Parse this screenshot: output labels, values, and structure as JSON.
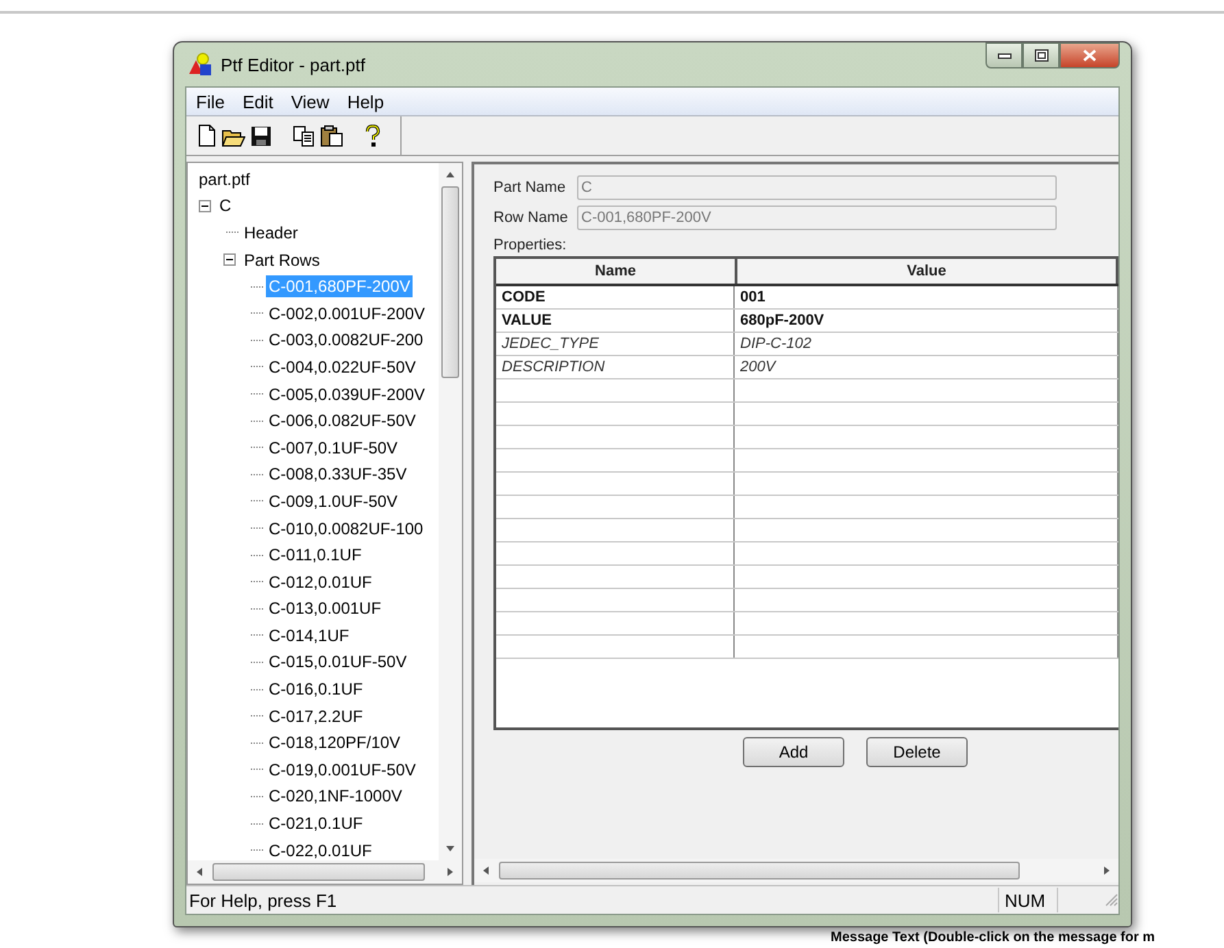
{
  "background": {
    "message_header": "Message Text (Double-click on the message for m"
  },
  "window": {
    "title": "Ptf Editor - part.ptf"
  },
  "menu": [
    "File",
    "Edit",
    "View",
    "Help"
  ],
  "tree": {
    "label": "part.ptf",
    "children": [
      {
        "label": "C",
        "expanded": true,
        "children": [
          {
            "label": "Header"
          },
          {
            "label": "Part Rows",
            "expanded": true,
            "children": [
              {
                "label": "C-001,680PF-200V",
                "selected": true
              },
              {
                "label": "C-002,0.001UF-200V",
                "selected": false
              },
              {
                "label": "C-003,0.0082UF-200",
                "selected": false
              },
              {
                "label": "C-004,0.022UF-50V",
                "selected": false
              },
              {
                "label": "C-005,0.039UF-200V",
                "selected": false
              },
              {
                "label": "C-006,0.082UF-50V",
                "selected": false
              },
              {
                "label": "C-007,0.1UF-50V",
                "selected": false
              },
              {
                "label": "C-008,0.33UF-35V",
                "selected": false
              },
              {
                "label": "C-009,1.0UF-50V",
                "selected": false
              },
              {
                "label": "C-010,0.0082UF-100",
                "selected": false
              },
              {
                "label": "C-011,0.1UF",
                "selected": false
              },
              {
                "label": "C-012,0.01UF",
                "selected": false
              },
              {
                "label": "C-013,0.001UF",
                "selected": false
              },
              {
                "label": "C-014,1UF",
                "selected": false
              },
              {
                "label": "C-015,0.01UF-50V",
                "selected": false
              },
              {
                "label": "C-016,0.1UF",
                "selected": false
              },
              {
                "label": "C-017,2.2UF",
                "selected": false
              },
              {
                "label": "C-018,120PF/10V",
                "selected": false
              },
              {
                "label": "C-019,0.001UF-50V",
                "selected": false
              },
              {
                "label": "C-020,1NF-1000V",
                "selected": false
              },
              {
                "label": "C-021,0.1UF",
                "selected": false
              },
              {
                "label": "C-022,0.01UF",
                "selected": false
              }
            ]
          }
        ]
      }
    ]
  },
  "form": {
    "fields": [
      {
        "label": "Part Name",
        "value": "C",
        "disabled": true
      },
      {
        "label": "Row Name",
        "value": "C-001,680PF-200V",
        "disabled": true
      }
    ],
    "properties_label": "Properties:"
  },
  "table": {
    "columns": [
      "Name",
      "Value"
    ],
    "rows": [
      {
        "name": "CODE",
        "value": "001",
        "kind": "bold"
      },
      {
        "name": "VALUE",
        "value": "680pF-200V",
        "kind": "bold"
      },
      {
        "name": "JEDEC_TYPE",
        "value": "DIP-C-102",
        "kind": "italic"
      },
      {
        "name": "DESCRIPTION",
        "value": "200V",
        "kind": "italic"
      }
    ]
  },
  "buttons": [
    "Add",
    "Delete"
  ],
  "status_bar": {
    "text": "For Help, press F1",
    "indicators": [
      "NUM"
    ]
  }
}
